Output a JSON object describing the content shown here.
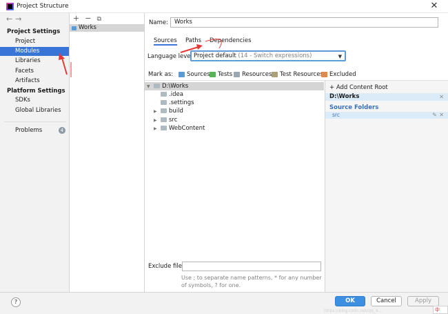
{
  "window": {
    "title": "Project Structure"
  },
  "sidebar": {
    "sections": [
      {
        "title": "Project Settings",
        "items": [
          "Project",
          "Modules",
          "Libraries",
          "Facets",
          "Artifacts"
        ]
      },
      {
        "title": "Platform Settings",
        "items": [
          "SDKs",
          "Global Libraries"
        ]
      }
    ],
    "selected": "Modules",
    "problems": {
      "label": "Problems",
      "count": "4"
    }
  },
  "modules": {
    "items": [
      "Works"
    ]
  },
  "module": {
    "name_label": "Name:",
    "name_value": "Works",
    "tabs": [
      "Sources",
      "Paths",
      "Dependencies"
    ],
    "active_tab": "Sources",
    "language_label": "Language level:",
    "language_value": "Project default",
    "language_detail": "(14 - Switch expressions)",
    "mark_as_label": "Mark as:",
    "mark_as": [
      {
        "label": "Sources",
        "color": "#5b9bd5"
      },
      {
        "label": "Tests",
        "color": "#59b159"
      },
      {
        "label": "Resources",
        "color": "#9aa6b2"
      },
      {
        "label": "Test Resources",
        "color": "#a8a17a"
      },
      {
        "label": "Excluded",
        "color": "#e08a4c"
      }
    ],
    "tree": [
      {
        "label": "D:\\Works",
        "level": 0,
        "expanded": true
      },
      {
        "label": ".idea",
        "level": 1
      },
      {
        "label": ".settings",
        "level": 1
      },
      {
        "label": "build",
        "level": 1,
        "collapsed": true
      },
      {
        "label": "src",
        "level": 1,
        "collapsed": true
      },
      {
        "label": "WebContent",
        "level": 1,
        "collapsed": true
      }
    ],
    "exclude_label": "Exclude files:",
    "exclude_hint": "Use ; to separate name patterns, * for any number of symbols, ? for one."
  },
  "roots": {
    "add_label": "+ Add Content Root",
    "root_path": "D:\\Works",
    "source_folders_label": "Source Folders",
    "source_entry": "src"
  },
  "footer": {
    "help": "?",
    "ok": "OK",
    "cancel": "Cancel",
    "apply": "Apply",
    "watermark": "https://blog.csdn.net/qq_4...",
    "ime": "中"
  },
  "colors": {
    "accent": "#3875d6",
    "annotation": "#e53935"
  }
}
